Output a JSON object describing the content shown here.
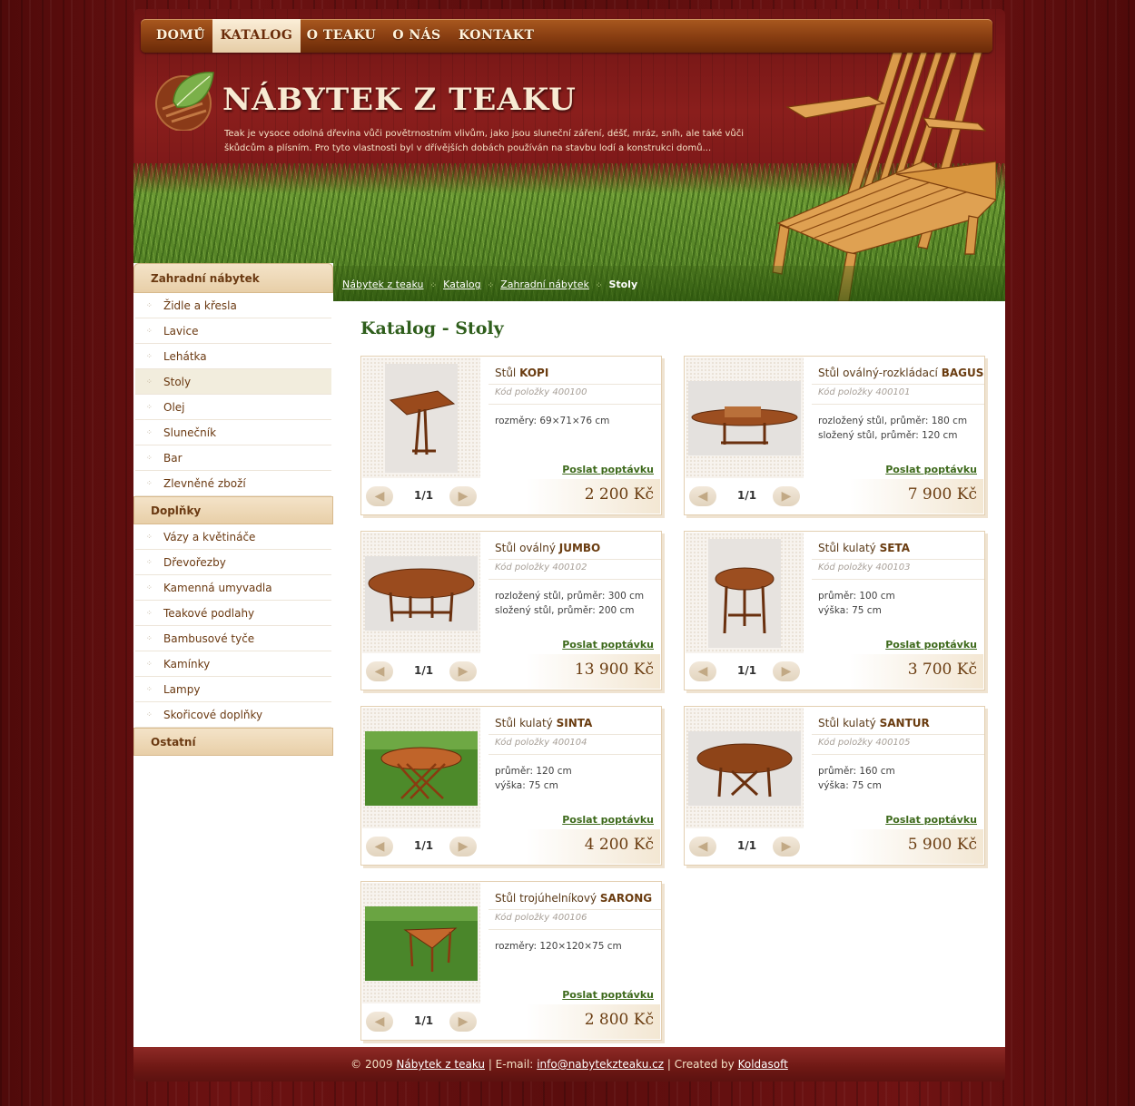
{
  "nav": {
    "items": [
      {
        "label": "DOMŮ"
      },
      {
        "label": "KATALOG"
      },
      {
        "label": "O TEAKU"
      },
      {
        "label": "O NÁS"
      },
      {
        "label": "KONTAKT"
      }
    ]
  },
  "header": {
    "title": "NÁBYTEK Z TEAKU",
    "description": "Teak je vysoce odolná dřevina vůči povětrnostním vlivům, jako jsou sluneční záření, déšť, mráz, sníh, ale také vůči škůdcům a plísním. Pro tyto vlastnosti byl v dřívějších dobách používán na stavbu lodí a konstrukci domů..."
  },
  "breadcrumb": {
    "items": [
      "Nábytek z teaku",
      "Katalog",
      "Zahradní nábytek"
    ],
    "current": "Stoly"
  },
  "sidebar": {
    "sections": [
      {
        "title": "Zahradní nábytek",
        "items": [
          "Židle a křesla",
          "Lavice",
          "Lehátka",
          "Stoly",
          "Olej",
          "Slunečník",
          "Bar",
          "Zlevněné zboží"
        ]
      },
      {
        "title": "Doplňky",
        "items": [
          "Vázy a květináče",
          "Dřevořezby",
          "Kamenná umyvadla",
          "Teakové podlahy",
          "Bambusové tyče",
          "Kamínky",
          "Lampy",
          "Skořicové doplňky"
        ]
      },
      {
        "title": "Ostatní",
        "items": []
      }
    ],
    "active_item": "Stoly"
  },
  "main": {
    "title": "Katalog - Stoly",
    "request_label": "Poslat poptávku",
    "products": [
      {
        "prefix": "Stůl",
        "name": "KOPI",
        "code": "Kód položky 400100",
        "dims": [
          "rozměry: 69×71×76 cm"
        ],
        "pager": "1/1",
        "price": "2 200 Kč"
      },
      {
        "prefix": "Stůl oválný-rozkládací",
        "name": "BAGUS",
        "code": "Kód položky 400101",
        "dims": [
          "rozložený stůl, průměr: 180 cm",
          "složený stůl, průměr: 120 cm"
        ],
        "pager": "1/1",
        "price": "7 900 Kč"
      },
      {
        "prefix": "Stůl oválný",
        "name": "JUMBO",
        "code": "Kód položky 400102",
        "dims": [
          "rozložený stůl, průměr: 300 cm",
          "složený stůl, průměr: 200 cm"
        ],
        "pager": "1/1",
        "price": "13 900 Kč"
      },
      {
        "prefix": "Stůl kulatý",
        "name": "SETA",
        "code": "Kód položky 400103",
        "dims": [
          "průměr: 100 cm",
          "výška: 75 cm"
        ],
        "pager": "1/1",
        "price": "3 700 Kč"
      },
      {
        "prefix": "Stůl kulatý",
        "name": "SINTA",
        "code": "Kód položky 400104",
        "dims": [
          "průměr: 120 cm",
          "výška: 75 cm"
        ],
        "pager": "1/1",
        "price": "4 200 Kč"
      },
      {
        "prefix": "Stůl kulatý",
        "name": "SANTUR",
        "code": "Kód položky 400105",
        "dims": [
          "průměr: 160 cm",
          "výška: 75 cm"
        ],
        "pager": "1/1",
        "price": "5 900 Kč"
      },
      {
        "prefix": "Stůl trojúhelníkový",
        "name": "SARONG",
        "code": "Kód položky 400106",
        "dims": [
          "rozměry: 120×120×75 cm"
        ],
        "pager": "1/1",
        "price": "2 800 Kč"
      }
    ]
  },
  "footer": {
    "copyright": "© 2009",
    "site_link": "Nábytek z teaku",
    "email_label": "| E-mail:",
    "email": "info@nabytekzteaku.cz",
    "created_label": "| Created by",
    "creator": "Koldasoft"
  },
  "colors": {
    "brand_red": "#7b1818",
    "nav_brown": "#8a3f12",
    "heading_green": "#2f5e1c",
    "text_brown": "#6b3a12"
  }
}
